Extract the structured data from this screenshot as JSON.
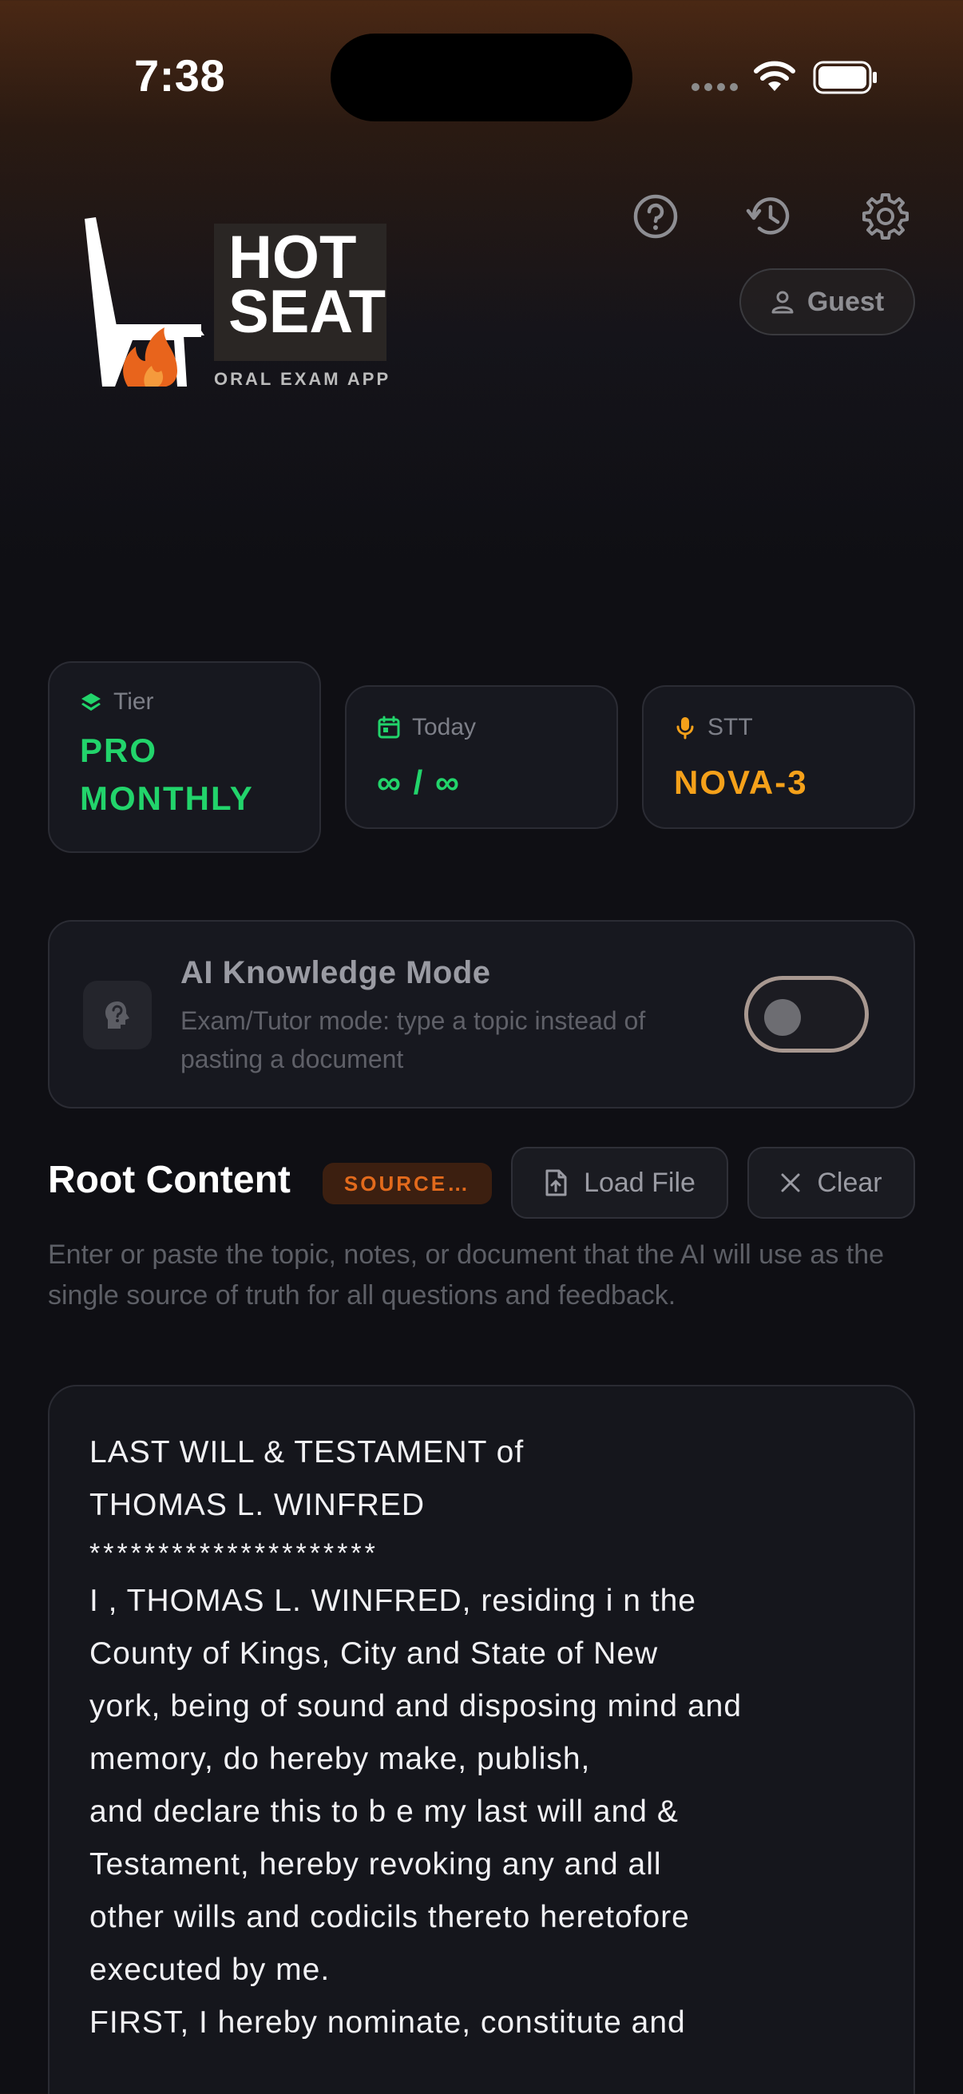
{
  "status_bar": {
    "time": "7:38"
  },
  "header": {
    "logo": {
      "line1": "HOT",
      "line2": "SEAT",
      "tagline": "ORAL EXAM APP"
    },
    "guest_label": "Guest"
  },
  "stats": {
    "tier": {
      "label": "Tier",
      "value_line1": "PRO",
      "value_line2": "MONTHLY"
    },
    "today": {
      "label": "Today",
      "value": "∞ / ∞"
    },
    "stt": {
      "label": "STT",
      "value": "NOVA-3"
    }
  },
  "ai_mode": {
    "title": "AI Knowledge Mode",
    "description": "Exam/Tutor mode: type a topic instead of pasting a document",
    "enabled": false
  },
  "root_content": {
    "title": "Root Content",
    "badge": "SOURCE…",
    "load_label": "Load File",
    "clear_label": "Clear",
    "description": "Enter or paste the topic, notes, or document that the AI will use as the single source of truth for all questions and feedback.",
    "lines": [
      "LAST WILL & TESTAMENT of",
      "THOMAS L. WINFRED",
      "*********************",
      "I , THOMAS L. WINFRED, residing i n the",
      "County of Kings, City and State of New",
      "york, being of sound and disposing mind and",
      "memory, do hereby make, publish,",
      "and declare this to b e my last will and &",
      "Testament, hereby revoking any and all",
      "other wills and codicils thereto heretofore",
      "executed by me.",
      "FIRST, I hereby nominate, constitute and"
    ]
  },
  "colors": {
    "accent_green": "#22d46b",
    "accent_orange": "#f5a11a",
    "flame": "#e8641c",
    "background": "#0f0f14"
  }
}
